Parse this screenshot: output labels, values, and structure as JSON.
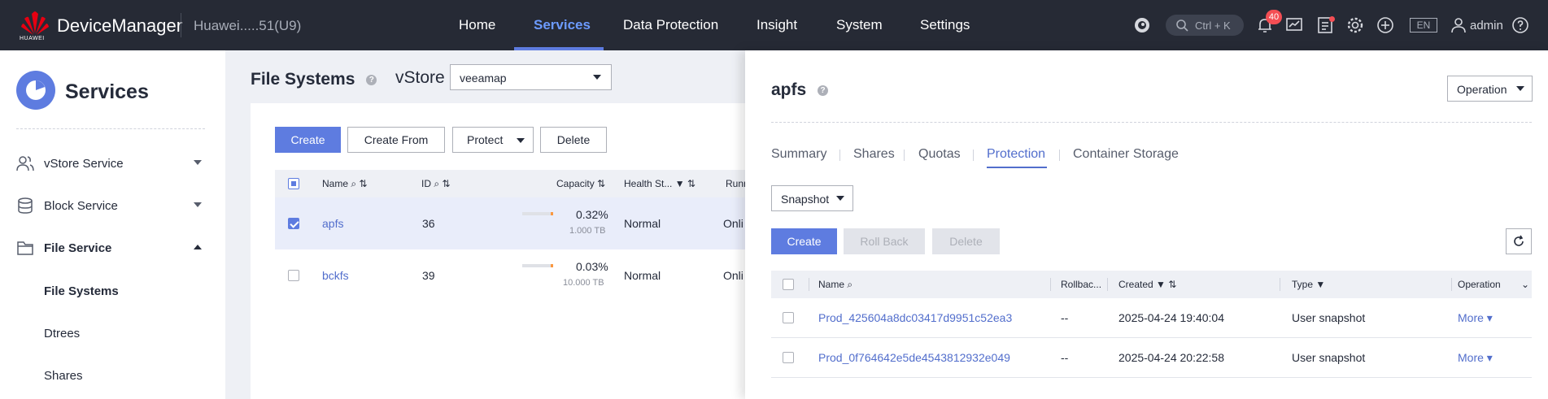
{
  "topbar": {
    "logo_text": "HUAWEI",
    "brand": "DeviceManager",
    "device": "Huawei.....51(U9)",
    "nav": [
      "Home",
      "Services",
      "Data Protection",
      "Insight",
      "System",
      "Settings"
    ],
    "active_nav": "Services",
    "search_hint": "Ctrl + K",
    "alarm_count": "40",
    "lang": "EN",
    "user": "admin",
    "accent": "#5e7ce0"
  },
  "sidebar": {
    "title": "Services",
    "items": [
      {
        "label": "vStore Service",
        "icon": "users-icon",
        "expanded": false
      },
      {
        "label": "Block Service",
        "icon": "database-icon",
        "expanded": false
      },
      {
        "label": "File Service",
        "icon": "folder-icon",
        "expanded": true
      }
    ],
    "sub_items": [
      "File Systems",
      "Dtrees",
      "Shares"
    ],
    "active_sub": "File Systems"
  },
  "main": {
    "title": "File Systems",
    "vstore_label": "vStore",
    "vstore_value": "veeamap",
    "buttons": {
      "create": "Create",
      "create_from": "Create From",
      "protect": "Protect",
      "delete": "Delete"
    },
    "columns": [
      "Name",
      "ID",
      "Capacity",
      "Health St...",
      "Runn"
    ],
    "rows": [
      {
        "name": "apfs",
        "id": "36",
        "capacity_pct": "0.32%",
        "capacity_total": "1.000 TB",
        "health": "Normal",
        "running": "Onli",
        "selected": true
      },
      {
        "name": "bckfs",
        "id": "39",
        "capacity_pct": "0.03%",
        "capacity_total": "10.000 TB",
        "health": "Normal",
        "running": "Onli",
        "selected": false
      }
    ]
  },
  "drawer": {
    "title": "apfs",
    "operation": "Operation",
    "tabs": [
      "Summary",
      "Shares",
      "Quotas",
      "Protection",
      "Container Storage"
    ],
    "active_tab": "Protection",
    "type_select": "Snapshot",
    "buttons": {
      "create": "Create",
      "rollback": "Roll Back",
      "delete": "Delete"
    },
    "columns": {
      "name": "Name",
      "rollback": "Rollbac...",
      "created": "Created",
      "type": "Type",
      "operation": "Operation"
    },
    "rows": [
      {
        "name": "Prod_425604a8dc03417d9951c52ea3",
        "rollback": "--",
        "created": "2025-04-24 19:40:04",
        "type": "User snapshot",
        "op": "More"
      },
      {
        "name": "Prod_0f764642e5de4543812932e049",
        "rollback": "--",
        "created": "2025-04-24 20:22:58",
        "type": "User snapshot",
        "op": "More"
      }
    ]
  }
}
